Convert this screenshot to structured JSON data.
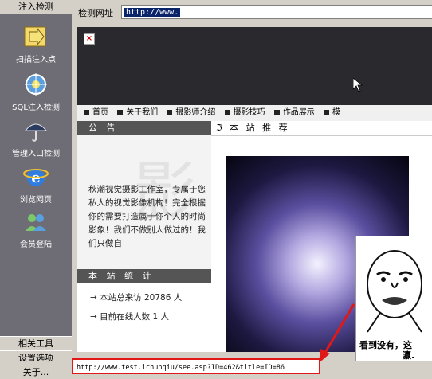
{
  "sidebar": {
    "header": "注入检测",
    "items": [
      {
        "label": "扫描注入点",
        "icon": "arrow-folder-icon"
      },
      {
        "label": "SQL注入检测",
        "icon": "globe-gear-icon"
      },
      {
        "label": "管理入口检测",
        "icon": "umbrella-icon"
      },
      {
        "label": "浏览网页",
        "icon": "ie-browser-icon"
      },
      {
        "label": "会员登陆",
        "icon": "users-icon"
      }
    ],
    "bottom": [
      "相关工具",
      "设置选项",
      "关于..."
    ]
  },
  "toolbar": {
    "url_label": "检测网址",
    "url_value": "http://www."
  },
  "nav": {
    "items": [
      "首页",
      "关于我们",
      "摄影师介绍",
      "摄影技巧",
      "作品展示",
      "模"
    ]
  },
  "notice": {
    "title": "公 告",
    "text": "秋潮视觉摄影工作室，专属于您私人的视觉影像机构！完全根据你的需要打造属于你个人的时尚影象！我们不做别人做过的！我们只做自",
    "watermark": "影"
  },
  "stats": {
    "title": "本 站 统 计",
    "rows": [
      {
        "label": "本站总来访",
        "value": "20786",
        "unit": "人"
      },
      {
        "label": "目前在线人数",
        "value": "1",
        "unit": "人"
      }
    ]
  },
  "recommend": {
    "title": "本 站 推 荐"
  },
  "meme": {
    "caption": "看到没有，这",
    "sub": "瀛."
  },
  "status": {
    "url": "http://www.test.ichunqiu/see.asp?ID=462&title=ID=86"
  },
  "colors": {
    "sidebar_bg": "#6e6d75",
    "highlight_box": "#e01818",
    "arrow": "#e01818",
    "url_highlight": "#0a246a"
  }
}
